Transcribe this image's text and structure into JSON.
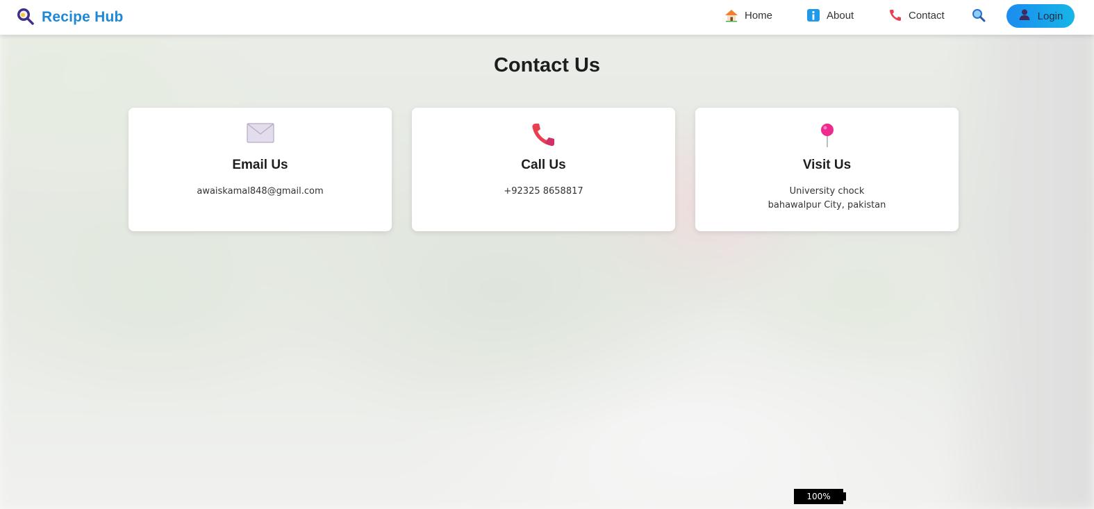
{
  "navbar": {
    "brand": "Recipe Hub",
    "items": [
      {
        "label": "Home",
        "icon": "house-icon"
      },
      {
        "label": "About",
        "icon": "info-icon"
      },
      {
        "label": "Contact",
        "icon": "telephone-icon"
      }
    ],
    "search_icon": "magnifier-icon",
    "login_label": "Login"
  },
  "page": {
    "title": "Contact Us"
  },
  "cards": [
    {
      "title": "Email Us",
      "icon": "envelope-icon",
      "lines": [
        "awaiskamal848@gmail.com"
      ]
    },
    {
      "title": "Call Us",
      "icon": "telephone-icon",
      "lines": [
        "+92325 8658817"
      ]
    },
    {
      "title": "Visit Us",
      "icon": "pin-icon",
      "lines": [
        "University chock",
        "bahawalpur City, pakistan"
      ]
    }
  ],
  "battery": {
    "level": "100%"
  },
  "colors": {
    "brand": "#1e88d6",
    "login_gradient_start": "#1c8cf0",
    "login_gradient_end": "#15b6e6",
    "pin": "#ec2b8c",
    "phone": "#e8404f"
  }
}
